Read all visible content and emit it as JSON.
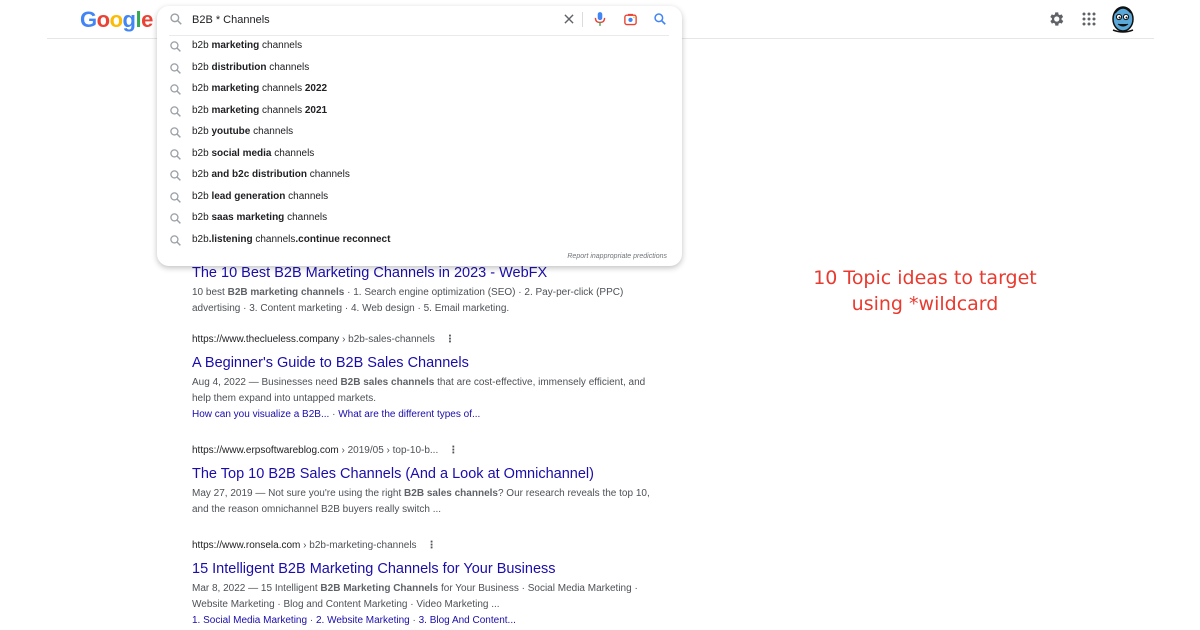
{
  "logo": {
    "letters": [
      "G",
      "o",
      "o",
      "g",
      "l",
      "e"
    ]
  },
  "search": {
    "value": "B2B * Channels",
    "icons": [
      "search-icon",
      "clear-icon",
      "mic-icon",
      "lens-icon",
      "search-submit-icon"
    ]
  },
  "suggestions": [
    {
      "parts": [
        {
          "t": "b2b ",
          "b": false
        },
        {
          "t": "marketing",
          "b": true
        },
        {
          "t": " channels",
          "b": false
        }
      ]
    },
    {
      "parts": [
        {
          "t": "b2b ",
          "b": false
        },
        {
          "t": "distribution",
          "b": true
        },
        {
          "t": " channels",
          "b": false
        }
      ]
    },
    {
      "parts": [
        {
          "t": "b2b ",
          "b": false
        },
        {
          "t": "marketing",
          "b": true
        },
        {
          "t": " channels ",
          "b": false
        },
        {
          "t": "2022",
          "b": true
        }
      ]
    },
    {
      "parts": [
        {
          "t": "b2b ",
          "b": false
        },
        {
          "t": "marketing",
          "b": true
        },
        {
          "t": " channels ",
          "b": false
        },
        {
          "t": "2021",
          "b": true
        }
      ]
    },
    {
      "parts": [
        {
          "t": "b2b ",
          "b": false
        },
        {
          "t": "youtube",
          "b": true
        },
        {
          "t": " channels",
          "b": false
        }
      ]
    },
    {
      "parts": [
        {
          "t": "b2b ",
          "b": false
        },
        {
          "t": "social media",
          "b": true
        },
        {
          "t": " channels",
          "b": false
        }
      ]
    },
    {
      "parts": [
        {
          "t": "b2b ",
          "b": false
        },
        {
          "t": "and b2c distribution",
          "b": true
        },
        {
          "t": " channels",
          "b": false
        }
      ]
    },
    {
      "parts": [
        {
          "t": "b2b ",
          "b": false
        },
        {
          "t": "lead generation",
          "b": true
        },
        {
          "t": " channels",
          "b": false
        }
      ]
    },
    {
      "parts": [
        {
          "t": "b2b ",
          "b": false
        },
        {
          "t": "saas marketing",
          "b": true
        },
        {
          "t": " channels",
          "b": false
        }
      ]
    },
    {
      "parts": [
        {
          "t": "b2b",
          "b": false
        },
        {
          "t": ".listening",
          "b": true
        },
        {
          "t": " channels",
          "b": false
        },
        {
          "t": ".continue reconnect",
          "b": true
        }
      ]
    }
  ],
  "report_text": "Report inappropriate predictions",
  "results": [
    {
      "cite": "",
      "path": "",
      "title": "The 10 Best B2B Marketing Channels in 2023 - WebFX",
      "snippet": [
        {
          "t": "10 best ",
          "b": false
        },
        {
          "t": "B2B marketing channels",
          "b": true
        },
        {
          "t": " · 1. Search engine optimization (SEO) · 2. Pay-per-click (PPC) advertising · 3. Content marketing · 4. Web design · 5. Email marketing.",
          "b": false
        }
      ],
      "links": []
    },
    {
      "cite": "https://www.theclueless.company",
      "path": " › b2b-sales-channels",
      "title": "A Beginner's Guide to B2B Sales Channels",
      "snippet": [
        {
          "t": "Aug 4, 2022 — Businesses need ",
          "b": false
        },
        {
          "t": "B2B sales channels",
          "b": true
        },
        {
          "t": " that are cost-effective, immensely efficient, and help them expand into untapped markets.",
          "b": false
        }
      ],
      "links": [
        "How can you visualize a B2B...",
        "What are the different types of..."
      ]
    },
    {
      "cite": "https://www.erpsoftwareblog.com",
      "path": " › 2019/05 › top-10-b...",
      "title": "The Top 10 B2B Sales Channels (And a Look at Omnichannel)",
      "snippet": [
        {
          "t": "May 27, 2019 — Not sure you're using the right ",
          "b": false
        },
        {
          "t": "B2B sales channels",
          "b": true
        },
        {
          "t": "? Our research reveals the top 10, and the reason omnichannel B2B buyers really switch ...",
          "b": false
        }
      ],
      "links": []
    },
    {
      "cite": "https://www.ronsela.com",
      "path": " › b2b-marketing-channels",
      "title": "15 Intelligent B2B Marketing Channels for Your Business",
      "snippet": [
        {
          "t": "Mar 8, 2022 — 15 Intelligent ",
          "b": false
        },
        {
          "t": "B2B Marketing Channels",
          "b": true
        },
        {
          "t": " for Your Business · Social Media Marketing · Website Marketing · Blog and Content Marketing · Video Marketing ...",
          "b": false
        }
      ],
      "links": [
        "1. Social Media Marketing",
        "2. Website Marketing",
        "3. Blog And Content..."
      ]
    }
  ],
  "annotation": {
    "line1": "10 Topic ideas to target",
    "line2": "using *wildcard"
  },
  "colors": {
    "link": "#1a0dab",
    "annotation": "#e83a2f",
    "text": "#202124",
    "muted": "#4d5156"
  }
}
